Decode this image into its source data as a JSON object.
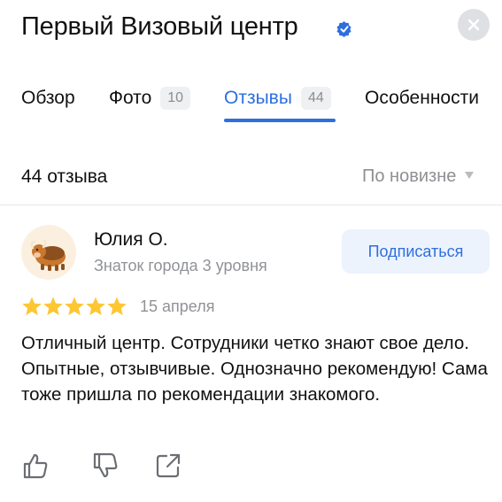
{
  "header": {
    "title": "Первый Визовый центр",
    "verified_icon": "verified-check-icon",
    "close_icon": "close-icon"
  },
  "tabs": [
    {
      "label": "Обзор",
      "count": null,
      "active": false
    },
    {
      "label": "Фото",
      "count": "10",
      "active": false
    },
    {
      "label": "Отзывы",
      "count": "44",
      "active": true
    },
    {
      "label": "Особенности",
      "count": null,
      "active": false
    }
  ],
  "reviews": {
    "count_label": "44 отзыва",
    "sort_label": "По новизне"
  },
  "review": {
    "author": "Юлия О.",
    "level": "Знаток города 3 уровня",
    "subscribe_label": "Подписаться",
    "rating": 5,
    "date": "15 апреля",
    "text": "Отличный центр. Сотрудники четко знают свое дело. Опытные, отзывчивые. Однозначно рекомендую! Сама тоже пришла по рекомендации знакомого.",
    "actions": [
      "like-icon",
      "dislike-icon",
      "share-icon"
    ]
  },
  "colors": {
    "accent": "#2d6fdf",
    "star": "#fdc733",
    "muted": "#909296"
  }
}
